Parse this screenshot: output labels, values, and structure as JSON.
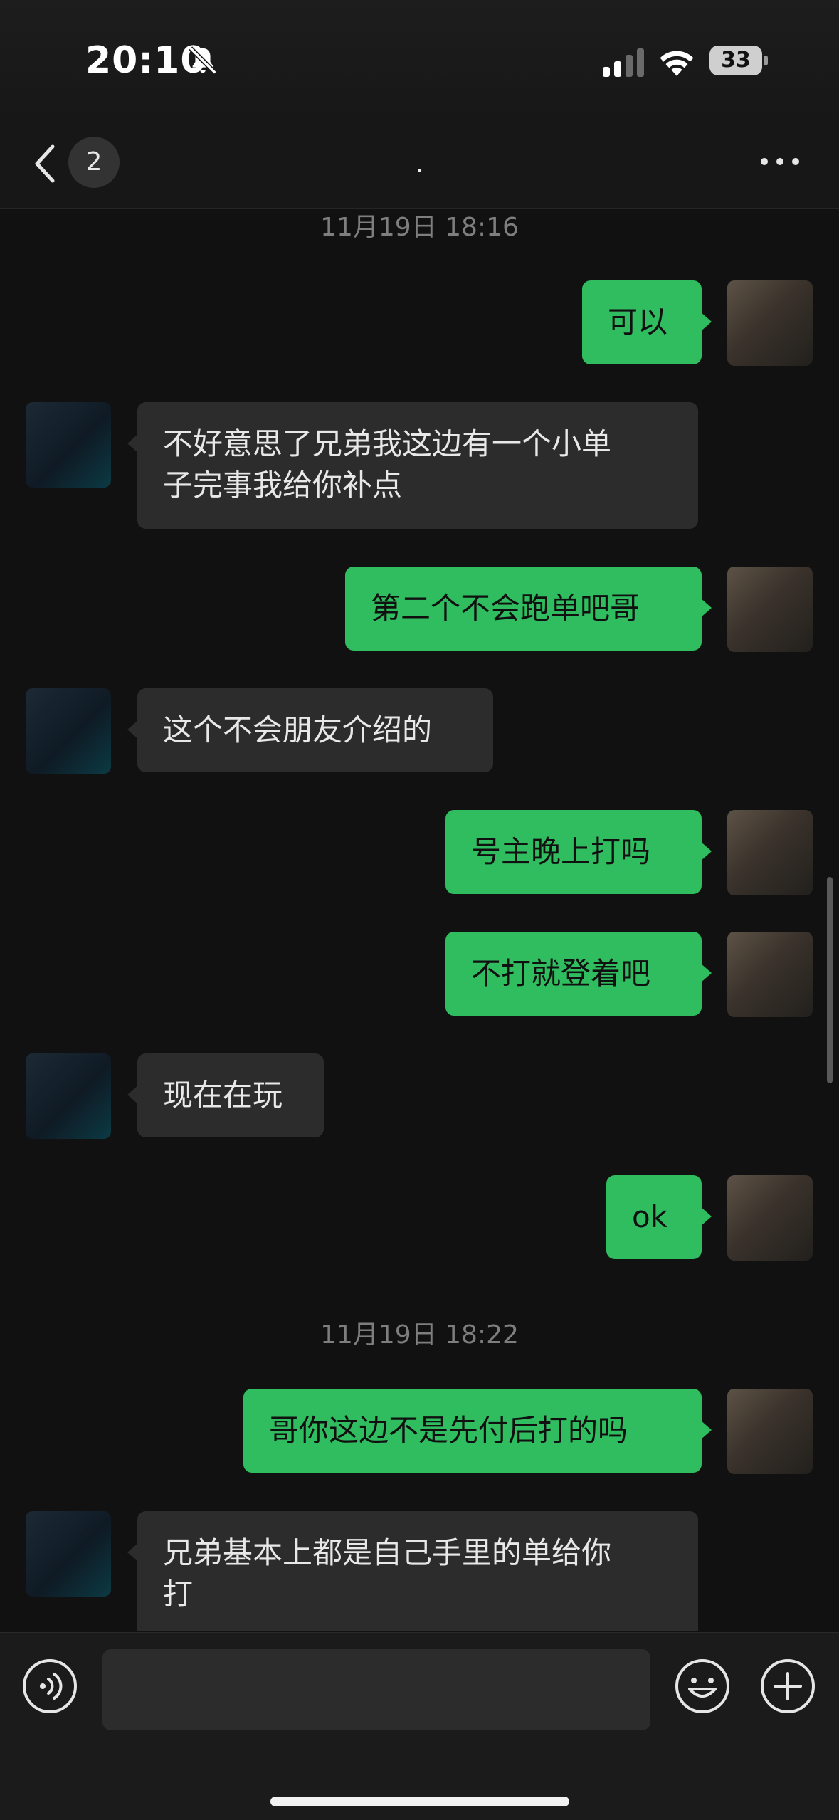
{
  "status_bar": {
    "time": "20:10",
    "battery": "33"
  },
  "nav": {
    "unread_count": "2",
    "title": "."
  },
  "messages": [
    {
      "type": "timestamp",
      "text": "11月19日 18:16"
    },
    {
      "type": "msg",
      "from": "me",
      "lines": [
        "可以"
      ]
    },
    {
      "type": "msg",
      "from": "other",
      "lines": [
        "不好意思了兄弟我这边有一个小单",
        "子完事我给你补点"
      ]
    },
    {
      "type": "msg",
      "from": "me",
      "lines": [
        "第二个不会跑单吧哥"
      ]
    },
    {
      "type": "msg",
      "from": "other",
      "lines": [
        "这个不会朋友介绍的"
      ]
    },
    {
      "type": "msg",
      "from": "me",
      "lines": [
        "号主晚上打吗"
      ]
    },
    {
      "type": "msg",
      "from": "me",
      "lines": [
        "不打就登着吧"
      ]
    },
    {
      "type": "msg",
      "from": "other",
      "lines": [
        "现在在玩"
      ]
    },
    {
      "type": "msg",
      "from": "me",
      "lines": [
        "ok"
      ]
    },
    {
      "type": "timestamp",
      "text": "11月19日 18:22"
    },
    {
      "type": "msg",
      "from": "me",
      "lines": [
        "哥你这边不是先付后打的吗"
      ]
    },
    {
      "type": "msg",
      "from": "other",
      "lines": [
        "兄弟基本上都是自己手里的单给你",
        "打"
      ]
    }
  ],
  "colors": {
    "bubble_me": "#2fbd5f",
    "bubble_other": "#2c2c2c",
    "background": "#111111"
  },
  "icons": {
    "voice": "voice-icon",
    "emoji": "emoji-icon",
    "plus": "plus-icon"
  }
}
